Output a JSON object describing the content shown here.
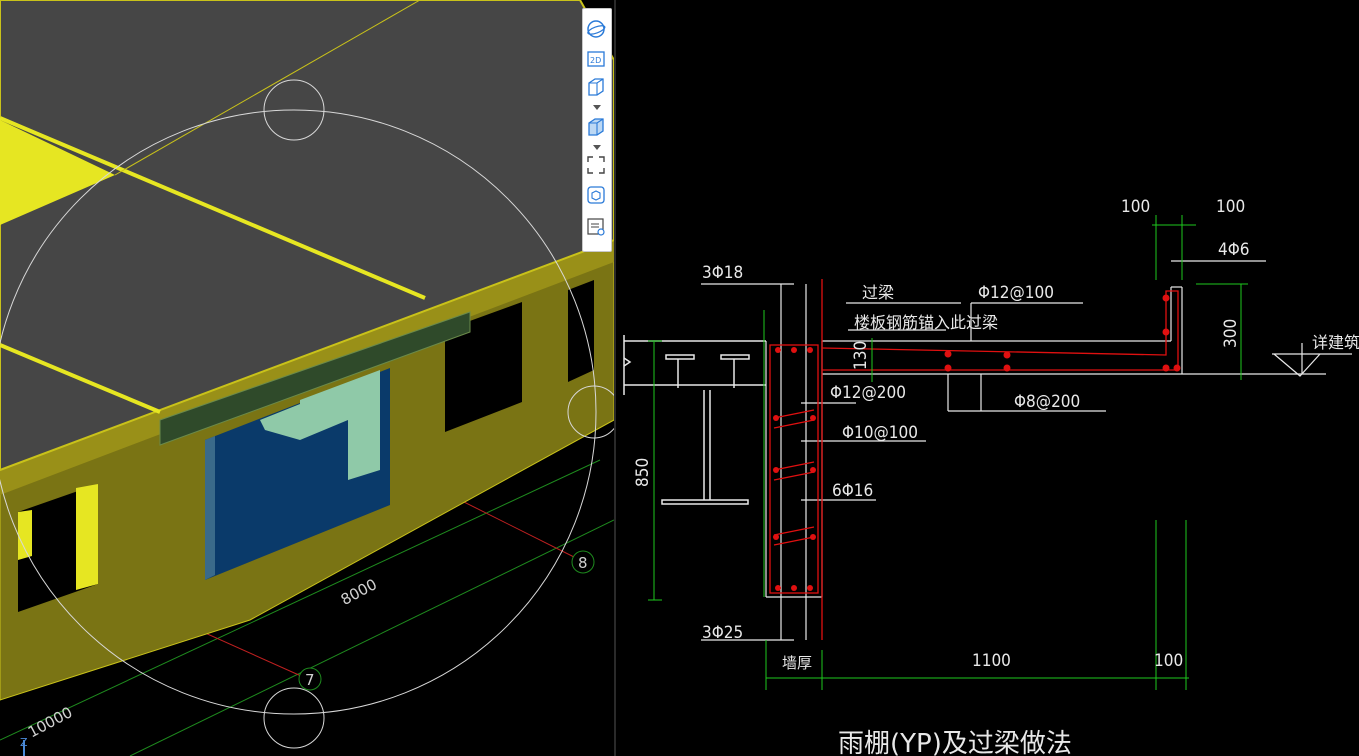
{
  "viewport3d": {
    "dimension_a": "8000",
    "dimension_b": "10000",
    "axis_7": "7",
    "axis_8": "8",
    "axis_z": "Z"
  },
  "toolbar": {
    "items": [
      "orbit-icon",
      "2d-icon",
      "cube-icon",
      "cube-shaded-icon",
      "zoom-extents-icon",
      "view-cube-icon",
      "display-settings-icon"
    ],
    "label_2d": "2D"
  },
  "cad": {
    "title": "雨棚(YP)及过梁做法",
    "labels": {
      "beam": "过梁",
      "slab_anchor": "楼板钢筋锚入此过梁",
      "top_bars": "3Φ18",
      "bottom_bars": "3Φ25",
      "slab_top": "Φ12@100",
      "stirrup_a": "Φ12@200",
      "stirrup_b": "Φ10@100",
      "side_bars": "6Φ16",
      "slab_dist": "Φ8@200",
      "edge_bars": "4Φ6",
      "see_arch": "详建筑",
      "wall_thick": "墙厚"
    },
    "dims": {
      "d100a": "100",
      "d100b": "100",
      "d300": "300",
      "d130": "130",
      "d850": "850",
      "d1100": "1100",
      "d100c": "100"
    }
  }
}
